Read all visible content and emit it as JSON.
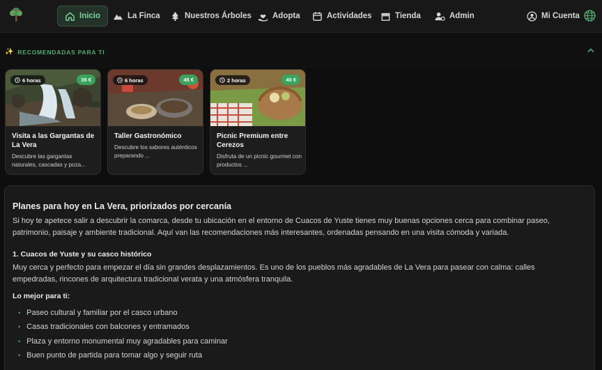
{
  "nav": {
    "items": [
      {
        "label": "Inicio",
        "icon": "home-icon",
        "active": true
      },
      {
        "label": "La Finca",
        "icon": "mountain-icon"
      },
      {
        "label": "Nuestros Árboles",
        "icon": "tree-icon"
      },
      {
        "label": "Adopta",
        "icon": "hand-heart-icon"
      },
      {
        "label": "Actividades",
        "icon": "calendar-icon"
      },
      {
        "label": "Tienda",
        "icon": "store-icon"
      },
      {
        "label": "Admin",
        "icon": "user-gear-icon"
      }
    ],
    "account_label": "Mi Cuenta",
    "accent_color": "#4cae6a"
  },
  "recommended": {
    "title": "RECOMENDADAS PARA TI",
    "cards": [
      {
        "duration": "6 horas",
        "price": "35 €",
        "title": "Visita a las Gargantas de La Vera",
        "description": "Descubre las gargantas naturales, cascadas y poza...",
        "image": "waterfall"
      },
      {
        "duration": "6 horas",
        "price": "45 €",
        "title": "Taller Gastronómico",
        "description": "Descubre los sabores auténticos preparando ...",
        "image": "cooking-pan"
      },
      {
        "duration": "2 horas",
        "price": "40 €",
        "title": "Picnic Premium entre Cerezos",
        "description": "Disfruta de un picnic gourmet con productos ...",
        "image": "picnic-basket"
      }
    ]
  },
  "article": {
    "title": "Planes para hoy en La Vera, priorizados por cercanía",
    "intro": "Si hoy te apetece salir a descubrir la comarca, desde tu ubicación en el entorno de Cuacos de Yuste tienes muy buenas opciones cerca para combinar paseo, patrimonio, paisaje y ambiente tradicional. Aquí van las recomendaciones más interesantes, ordenadas pensando en una visita cómoda y variada.",
    "section_title": "1. Cuacos de Yuste y su casco histórico",
    "section_text": "Muy cerca y perfecto para empezar el día sin grandes desplazamientos. Es uno de los pueblos más agradables de La Vera para pasear con calma: calles empedradas, rincones de arquitectura tradicional verata y una atmósfera tranquila.",
    "best_for_label": "Lo mejor para ti:",
    "bullets": [
      "Paseo cultural y familiar por el casco urbano",
      "Casas tradicionales con balcones y entramados",
      "Plaza y entorno monumental muy agradables para caminar",
      "Buen punto de partida para tomar algo y seguir ruta"
    ]
  }
}
